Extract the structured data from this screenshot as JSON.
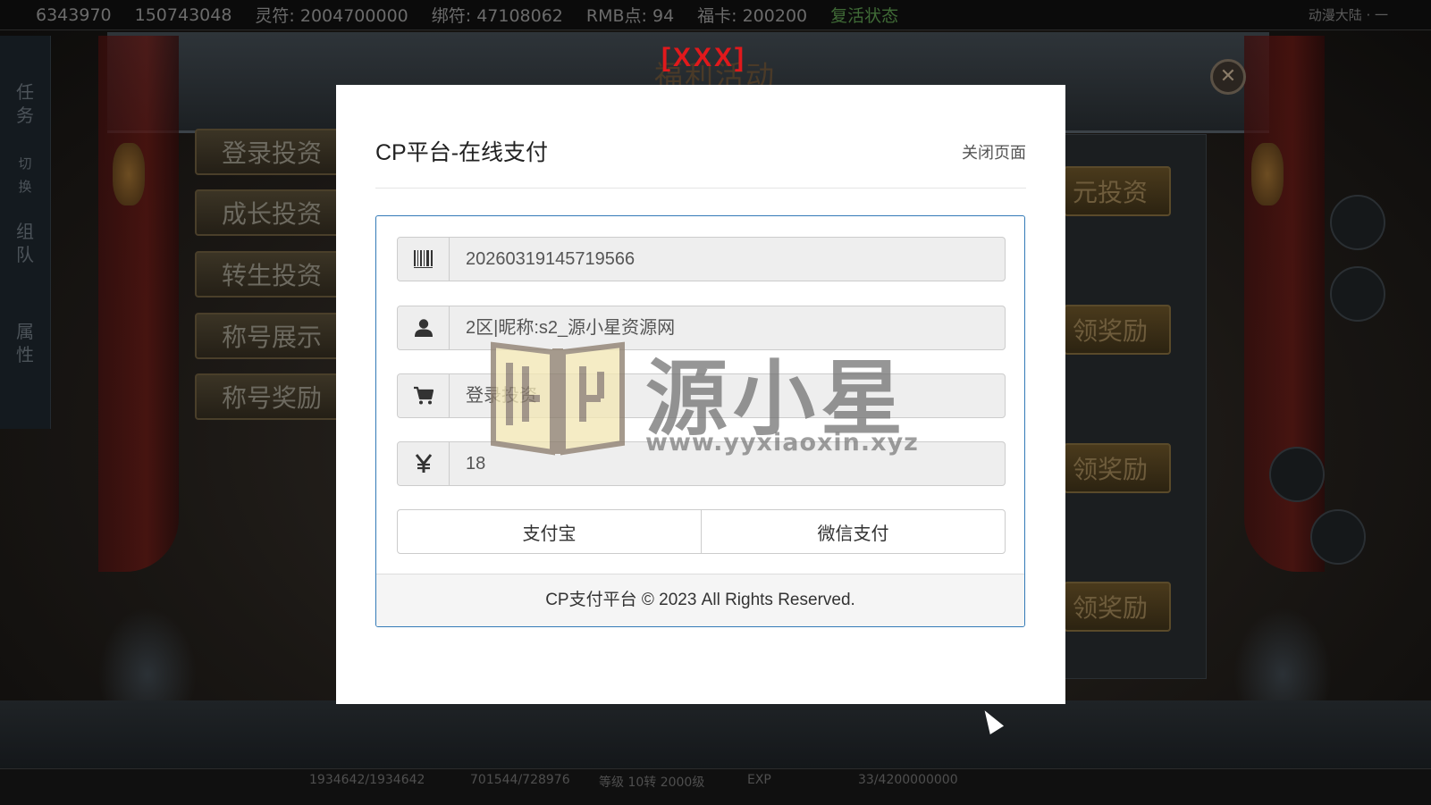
{
  "game": {
    "topbar": {
      "stat1": "6343970",
      "stat2": "150743048",
      "stat3": "灵符: 2004700000",
      "stat4": "绑符: 47108062",
      "stat5": "RMB点: 94",
      "stat6": "福卡: 200200",
      "status": "复活状态",
      "region": "动漫大陆 · 一"
    },
    "title": "福利活动",
    "left_tabs": [
      "任务",
      "切换",
      "组队",
      "属性"
    ],
    "menu": [
      "登录投资",
      "成长投资",
      "转生投资",
      "称号展示",
      "称号奖励"
    ],
    "right_buttons": [
      "元投资",
      "领奖励",
      "领奖励",
      "领奖励"
    ],
    "close_glyph": "✕",
    "red_label": "[XXX]",
    "bottombar": {
      "hp": "1934642/1934642",
      "mp": "701544/728976",
      "level": "等级 10转 2000级",
      "exp_label": "EXP",
      "exp": "33/4200000000"
    }
  },
  "modal": {
    "title": "CP平台-在线支付",
    "close_label": "关闭页面",
    "fields": [
      {
        "icon": "barcode-icon",
        "value": "20260319145719566"
      },
      {
        "icon": "user-icon",
        "value": "2区|昵称:s2_源小星资源网"
      },
      {
        "icon": "cart-icon",
        "value": "登录投资"
      },
      {
        "icon": "yen-icon",
        "value": "18"
      }
    ],
    "buttons": {
      "alipay": "支付宝",
      "wechat": "微信支付"
    },
    "footer": "CP支付平台 © 2023 All Rights Reserved.",
    "border_color": "#337ab7"
  },
  "watermark": {
    "name": "源小星",
    "url": "www.yyxiaoxin.xyz"
  }
}
